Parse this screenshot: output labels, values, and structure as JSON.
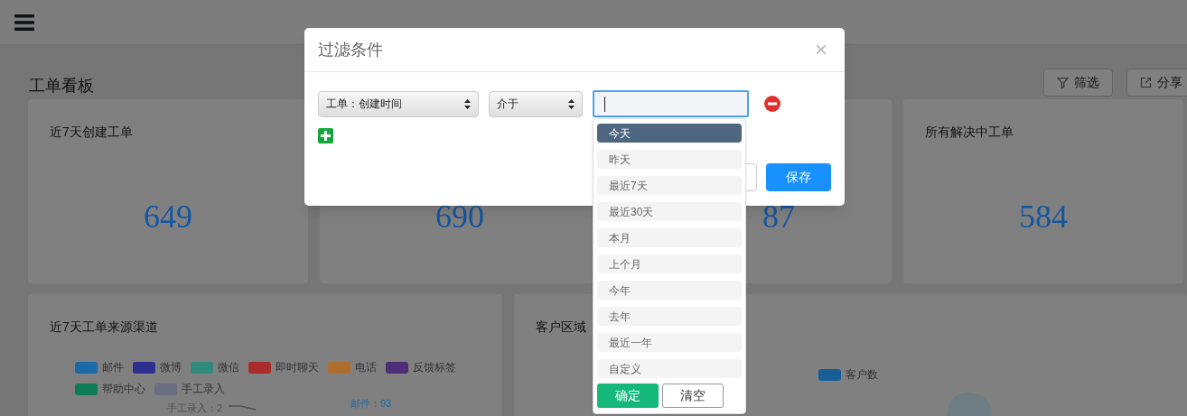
{
  "page": {
    "title": "工单看板",
    "actions": [
      {
        "kind": "filter",
        "label": "筛选"
      },
      {
        "kind": "share",
        "label": "分享"
      }
    ]
  },
  "stat_cards": [
    {
      "title": "近7天创建工单",
      "value": "649"
    },
    {
      "value": "690"
    },
    {
      "value": "87"
    },
    {
      "title": "所有解决中工单",
      "value": "584"
    }
  ],
  "source_chart": {
    "title": "近7天工单来源渠道",
    "legend": [
      {
        "label": "邮件",
        "color": "#1a6aa8"
      },
      {
        "label": "微博",
        "color": "#2e2e90"
      },
      {
        "label": "微信",
        "color": "#2e8a7a"
      },
      {
        "label": "即时聊天",
        "color": "#a82c2c"
      },
      {
        "label": "电话",
        "color": "#b06e2c"
      },
      {
        "label": "反馈标签",
        "color": "#4f2e78"
      },
      {
        "label": "帮助中心",
        "color": "#0e7a56"
      },
      {
        "label": "手工录入",
        "color": "#6a6e80"
      }
    ],
    "labels": [
      "手工录入：2",
      "邮件：93"
    ]
  },
  "region_chart": {
    "title": "客户区域",
    "legend": [
      {
        "label": "客户数",
        "color": "#155f96"
      }
    ]
  },
  "modal": {
    "title": "过滤条件",
    "close": "×",
    "field": "工单：创建时间",
    "operator": "介于",
    "save": "保存",
    "options": [
      {
        "label": "今天",
        "selected": true
      },
      {
        "label": "昨天",
        "selected": false
      },
      {
        "label": "最近7天",
        "selected": false
      },
      {
        "label": "最近30天",
        "selected": false
      },
      {
        "label": "本月",
        "selected": false
      },
      {
        "label": "上个月",
        "selected": false
      },
      {
        "label": "今年",
        "selected": false
      },
      {
        "label": "去年",
        "selected": false
      },
      {
        "label": "最近一年",
        "selected": false
      },
      {
        "label": "自定义",
        "selected": false
      }
    ],
    "confirm": "确定",
    "clear": "清空"
  }
}
